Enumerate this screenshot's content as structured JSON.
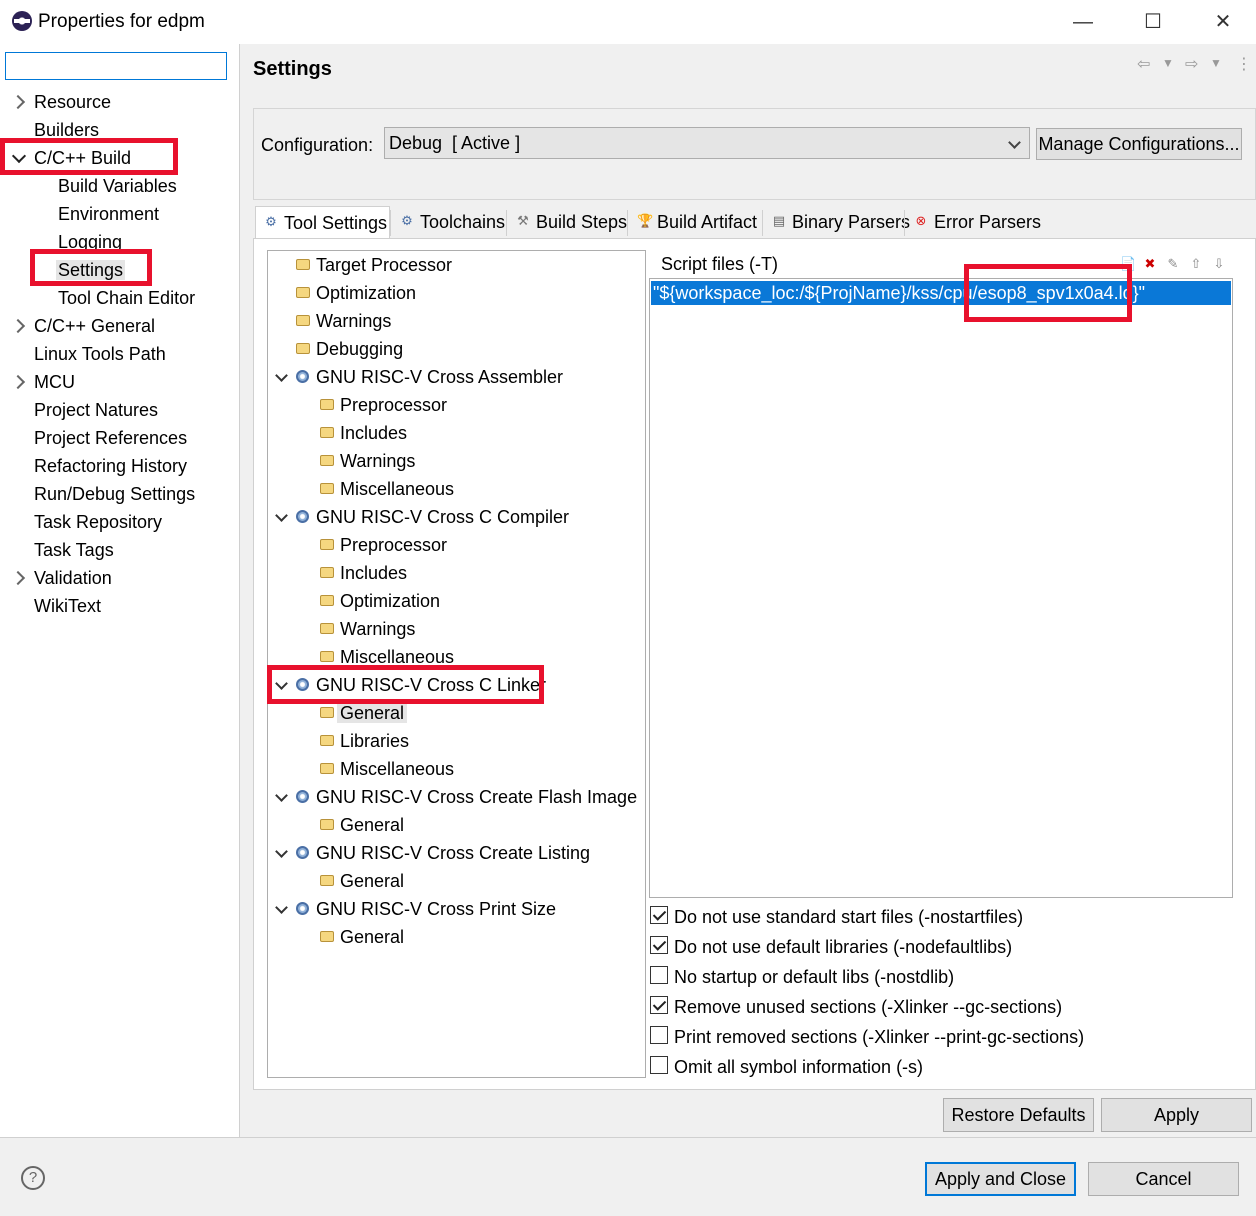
{
  "window": {
    "title": "Properties for edpm",
    "minimize_symbol": "—",
    "maximize_symbol": "☐",
    "close_symbol": "✕"
  },
  "filter": {
    "value": "",
    "placeholder": ""
  },
  "sidebar": {
    "items": [
      {
        "label": "Resource",
        "expander": "collapsed"
      },
      {
        "label": "Builders",
        "expander": "none"
      },
      {
        "label": "C/C++ Build",
        "expander": "expanded",
        "highlighted": true
      },
      {
        "label": "Build Variables",
        "child": true
      },
      {
        "label": "Environment",
        "child": true
      },
      {
        "label": "Logging",
        "child": true
      },
      {
        "label": "Settings",
        "child": true,
        "selected": true,
        "highlighted": true
      },
      {
        "label": "Tool Chain Editor",
        "child": true
      },
      {
        "label": "C/C++ General",
        "expander": "collapsed"
      },
      {
        "label": "Linux Tools Path",
        "expander": "none"
      },
      {
        "label": "MCU",
        "expander": "collapsed"
      },
      {
        "label": "Project Natures",
        "expander": "none"
      },
      {
        "label": "Project References",
        "expander": "none"
      },
      {
        "label": "Refactoring History",
        "expander": "none"
      },
      {
        "label": "Run/Debug Settings",
        "expander": "none"
      },
      {
        "label": "Task Repository",
        "expander": "none"
      },
      {
        "label": "Task Tags",
        "expander": "none"
      },
      {
        "label": "Validation",
        "expander": "collapsed"
      },
      {
        "label": "WikiText",
        "expander": "none"
      }
    ]
  },
  "page": {
    "title": "Settings",
    "nav_back": "⇦",
    "nav_forward": "⇨",
    "nav_menu": "⋮"
  },
  "configuration": {
    "label": "Configuration:",
    "value": "Debug  [ Active ]",
    "manage_button": "Manage Configurations..."
  },
  "tabs": [
    {
      "label": "Tool Settings",
      "icon": "gear-icon",
      "active": true
    },
    {
      "label": "Toolchains",
      "icon": "gear-icon"
    },
    {
      "label": "Build Steps",
      "icon": "hammer-icon"
    },
    {
      "label": "Build Artifact",
      "icon": "trophy-icon"
    },
    {
      "label": "Binary Parsers",
      "icon": "binary-icon"
    },
    {
      "label": "Error Parsers",
      "icon": "error-icon"
    }
  ],
  "tool_tree": [
    {
      "label": "Target Processor",
      "level": 0,
      "kind": "leaf"
    },
    {
      "label": "Optimization",
      "level": 0,
      "kind": "leaf"
    },
    {
      "label": "Warnings",
      "level": 0,
      "kind": "leaf"
    },
    {
      "label": "Debugging",
      "level": 0,
      "kind": "leaf"
    },
    {
      "label": "GNU RISC-V Cross Assembler",
      "level": 0,
      "kind": "tool",
      "expanded": true
    },
    {
      "label": "Preprocessor",
      "level": 1,
      "kind": "leaf"
    },
    {
      "label": "Includes",
      "level": 1,
      "kind": "leaf"
    },
    {
      "label": "Warnings",
      "level": 1,
      "kind": "leaf"
    },
    {
      "label": "Miscellaneous",
      "level": 1,
      "kind": "leaf"
    },
    {
      "label": "GNU RISC-V Cross C Compiler",
      "level": 0,
      "kind": "tool",
      "expanded": true
    },
    {
      "label": "Preprocessor",
      "level": 1,
      "kind": "leaf"
    },
    {
      "label": "Includes",
      "level": 1,
      "kind": "leaf"
    },
    {
      "label": "Optimization",
      "level": 1,
      "kind": "leaf"
    },
    {
      "label": "Warnings",
      "level": 1,
      "kind": "leaf"
    },
    {
      "label": "Miscellaneous",
      "level": 1,
      "kind": "leaf"
    },
    {
      "label": "GNU RISC-V Cross C Linker",
      "level": 0,
      "kind": "tool",
      "expanded": true,
      "highlighted": true
    },
    {
      "label": "General",
      "level": 1,
      "kind": "leaf",
      "selected": true
    },
    {
      "label": "Libraries",
      "level": 1,
      "kind": "leaf"
    },
    {
      "label": "Miscellaneous",
      "level": 1,
      "kind": "leaf"
    },
    {
      "label": "GNU RISC-V Cross Create Flash Image",
      "level": 0,
      "kind": "tool",
      "expanded": true
    },
    {
      "label": "General",
      "level": 1,
      "kind": "leaf"
    },
    {
      "label": "GNU RISC-V Cross Create Listing",
      "level": 0,
      "kind": "tool",
      "expanded": true
    },
    {
      "label": "General",
      "level": 1,
      "kind": "leaf"
    },
    {
      "label": "GNU RISC-V Cross Print Size",
      "level": 0,
      "kind": "tool",
      "expanded": true
    },
    {
      "label": "General",
      "level": 1,
      "kind": "leaf"
    }
  ],
  "script_files": {
    "label": "Script files (-T)",
    "entries": [
      "\"${workspace_loc:/${ProjName}/kss/cpu/esop8_spv1x0a4.ld}\""
    ]
  },
  "options": [
    {
      "label": "Do not use standard start files (-nostartfiles)",
      "checked": true
    },
    {
      "label": "Do not use default libraries (-nodefaultlibs)",
      "checked": true
    },
    {
      "label": "No startup or default libs (-nostdlib)",
      "checked": false
    },
    {
      "label": "Remove unused sections (-Xlinker --gc-sections)",
      "checked": true
    },
    {
      "label": "Print removed sections (-Xlinker --print-gc-sections)",
      "checked": false
    },
    {
      "label": "Omit all symbol information (-s)",
      "checked": false
    }
  ],
  "buttons": {
    "restore_defaults": "Restore Defaults",
    "apply": "Apply",
    "apply_and_close": "Apply and Close",
    "cancel": "Cancel",
    "help": "?"
  },
  "colors": {
    "highlight_box": "#e8112d",
    "selection": "#0a78d7"
  }
}
